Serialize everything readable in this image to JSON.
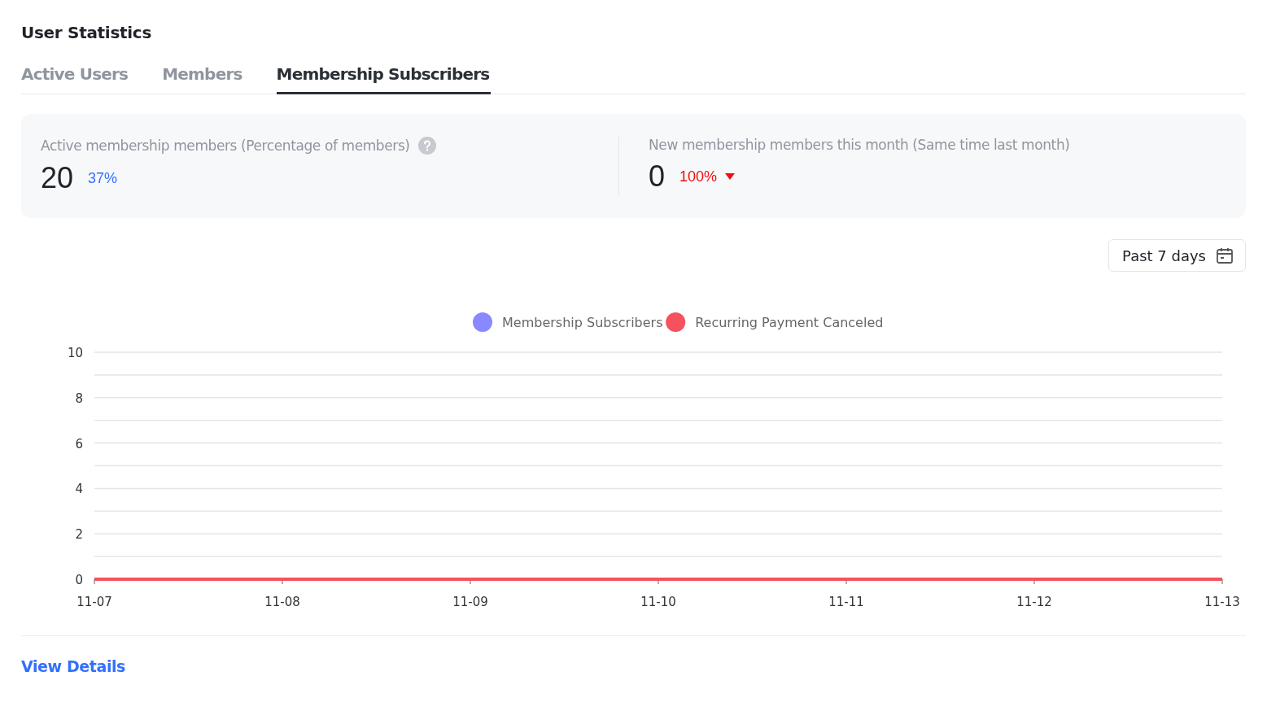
{
  "title": "User Statistics",
  "tabs": [
    {
      "label": "Active Users",
      "selected": false
    },
    {
      "label": "Members",
      "selected": false
    },
    {
      "label": "Membership Subscribers",
      "selected": true
    }
  ],
  "stats": [
    {
      "label": "Active membership members (Percentage of members)",
      "help": true,
      "value": "20",
      "change": "37%",
      "color": "#3370ff"
    },
    {
      "label": "New membership members this month (Same time last month)",
      "value": "0",
      "change": "100%",
      "color": "#f20d0d",
      "decrease": true
    }
  ],
  "date_range": {
    "label": "Past 7 days"
  },
  "chart_data": {
    "type": "line",
    "categories": [
      "11-07",
      "11-08",
      "11-09",
      "11-10",
      "11-11",
      "11-12",
      "11-13"
    ],
    "ylim": [
      0,
      10
    ],
    "yticks": [
      0,
      2,
      4,
      6,
      8,
      10
    ],
    "grid": true,
    "series": [
      {
        "name": "Membership Subscribers",
        "color": "#8888ff",
        "values": [
          null,
          null,
          null,
          null,
          null,
          null,
          null
        ]
      },
      {
        "name": "Recurring Payment Canceled",
        "color": "#f5515f",
        "values": [
          0,
          0,
          0,
          0,
          0,
          0,
          0
        ]
      }
    ]
  },
  "footer_link": "View Details"
}
